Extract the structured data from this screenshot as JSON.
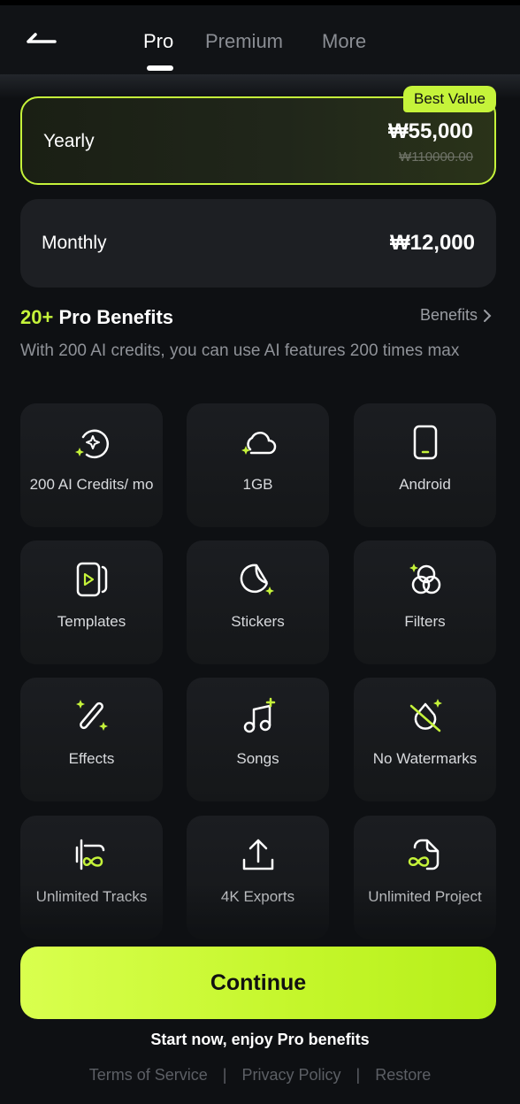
{
  "header": {
    "tabs": [
      {
        "label": "Pro",
        "active": true
      },
      {
        "label": "Premium",
        "active": false
      },
      {
        "label": "More",
        "active": false
      }
    ]
  },
  "plans": {
    "yearly": {
      "name": "Yearly",
      "price": "₩55,000",
      "old_price": "₩110000.00",
      "badge": "Best Value"
    },
    "monthly": {
      "name": "Monthly",
      "price": "₩12,000"
    }
  },
  "benefits": {
    "count_label": "20+",
    "title_label": "Pro Benefits",
    "link_label": "Benefits",
    "description": "With 200 AI credits, you can use AI features 200 times max",
    "items": [
      {
        "label": "200 AI Credits/ mo",
        "icon": "ai-credits-icon"
      },
      {
        "label": "1GB",
        "icon": "cloud-icon"
      },
      {
        "label": "Android",
        "icon": "phone-icon"
      },
      {
        "label": "Templates",
        "icon": "templates-icon"
      },
      {
        "label": "Stickers",
        "icon": "stickers-icon"
      },
      {
        "label": "Filters",
        "icon": "filters-icon"
      },
      {
        "label": "Effects",
        "icon": "magic-wand-icon"
      },
      {
        "label": "Songs",
        "icon": "music-note-icon"
      },
      {
        "label": "No Watermarks",
        "icon": "no-watermark-icon"
      },
      {
        "label": "Unlimited Tracks",
        "icon": "unlimited-tracks-icon"
      },
      {
        "label": "4K Exports",
        "icon": "upload-icon"
      },
      {
        "label": "Unlimited Project",
        "icon": "unlimited-project-icon"
      }
    ]
  },
  "cta": {
    "continue_label": "Continue",
    "tagline": "Start now, enjoy Pro benefits"
  },
  "footer": {
    "terms": "Terms of Service",
    "privacy": "Privacy Policy",
    "restore": "Restore",
    "separator": "|"
  },
  "colors": {
    "accent": "#c5f33a",
    "background": "#0e1013",
    "card": "#1d1f23"
  }
}
